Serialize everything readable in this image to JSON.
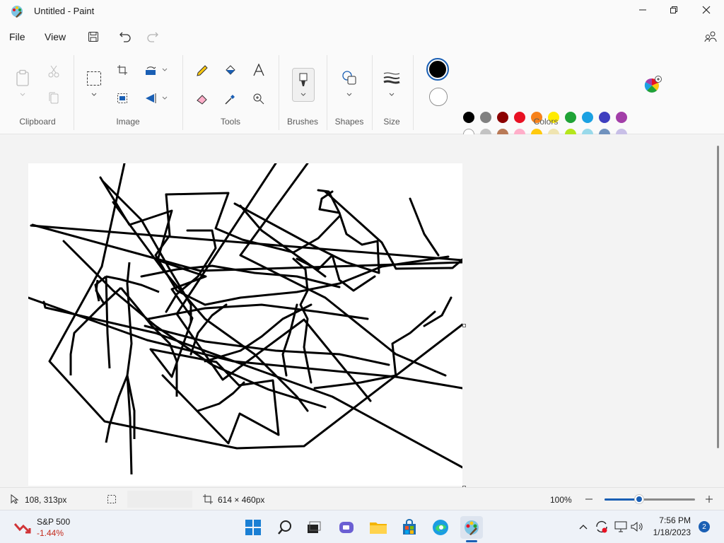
{
  "window": {
    "title": "Untitled - Paint"
  },
  "menu": {
    "file": "File",
    "view": "View"
  },
  "ribbon": {
    "groups": {
      "clipboard": "Clipboard",
      "image": "Image",
      "tools": "Tools",
      "brushes": "Brushes",
      "shapes": "Shapes",
      "size": "Size",
      "colors": "Colors"
    },
    "colors": {
      "primary": "#000000",
      "secondary": "#ffffff",
      "row1": [
        "#000000",
        "#808080",
        "#8b0000",
        "#e81123",
        "#f7821b",
        "#ffeb00",
        "#1fa336",
        "#1ba1e2",
        "#3f3fbf",
        "#a23ea8"
      ],
      "row2": [
        "#ffffff",
        "#c3c3c3",
        "#b97a57",
        "#ffaec9",
        "#ffc90e",
        "#efe4b0",
        "#b5e61d",
        "#99d9ea",
        "#7092be",
        "#c8bfe7"
      ],
      "row3_empty": 10
    }
  },
  "status": {
    "cursor_pos": "108, 313px",
    "canvas_size": "614 × 460px",
    "zoom": "100%",
    "zoom_fraction": 0.38
  },
  "taskbar": {
    "stock_name": "S&P 500",
    "stock_change": "-1.44%",
    "time": "7:56 PM",
    "date": "1/18/2023",
    "notifications": "2"
  }
}
